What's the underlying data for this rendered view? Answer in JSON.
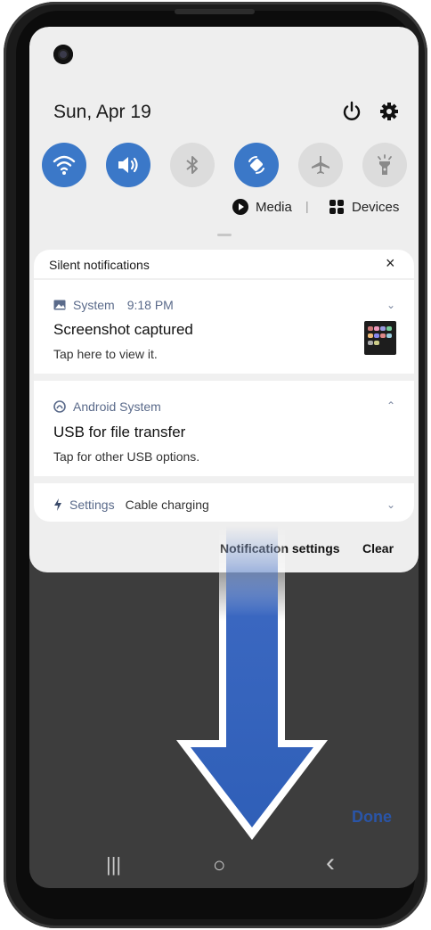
{
  "status": {
    "date": "Sun, Apr 19"
  },
  "quick_toggles": [
    {
      "icon": "wifi-icon",
      "state": "on"
    },
    {
      "icon": "sound-icon",
      "state": "on"
    },
    {
      "icon": "bluetooth-icon",
      "state": "off"
    },
    {
      "icon": "auto-rotate-icon",
      "state": "on"
    },
    {
      "icon": "airplane-icon",
      "state": "off"
    },
    {
      "icon": "flashlight-icon",
      "state": "off"
    }
  ],
  "media_bar": {
    "media_label": "Media",
    "separator": "|",
    "devices_label": "Devices"
  },
  "notifications": {
    "section_title": "Silent notifications",
    "close_label": "×",
    "items": [
      {
        "app": "System",
        "time": "9:18 PM",
        "title": "Screenshot captured",
        "body": "Tap here to view it.",
        "expand": "⌄"
      },
      {
        "app": "Android System",
        "title": "USB for file transfer",
        "body": "Tap for other USB options.",
        "expand": "⌃"
      },
      {
        "app": "Settings",
        "summary": "Cable charging",
        "expand": "⌄"
      }
    ],
    "settings_label": "Notification settings",
    "clear_label": "Clear"
  },
  "done_label": "Done",
  "navbar": {
    "recents": "|||",
    "home": "○",
    "back": "‹"
  },
  "colors": {
    "accent": "#3b78c8",
    "arrow": "#3a67c0",
    "panel": "#eeeeee"
  }
}
